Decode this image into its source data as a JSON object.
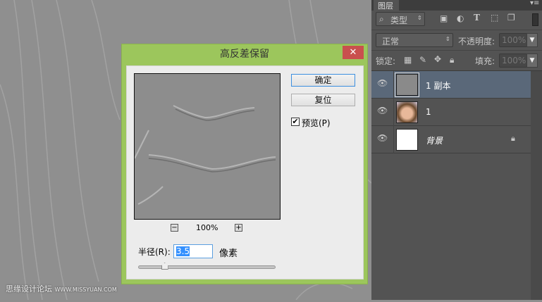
{
  "dialog": {
    "title": "高反差保留",
    "close_label": "✕",
    "ok_label": "确定",
    "reset_label": "复位",
    "preview_label": "预览(P)",
    "preview_checked": true,
    "zoom_out_label": "−",
    "zoom_level": "100%",
    "zoom_in_label": "+",
    "radius_label": "半径(R):",
    "radius_value": "3.5",
    "radius_unit": "像素",
    "radius_slider_fraction": 0.19
  },
  "layers_panel": {
    "tab_label": "图层",
    "filter_label": "类型",
    "blend_mode": "正常",
    "opacity_label": "不透明度:",
    "opacity_value": "100%",
    "lock_label": "锁定:",
    "fill_label": "填充:",
    "fill_value": "100%",
    "layers": [
      {
        "name": "1 副本",
        "selected": true,
        "thumb": "high-pass"
      },
      {
        "name": "1",
        "selected": false,
        "thumb": "photo"
      },
      {
        "name": "背景",
        "selected": false,
        "thumb": "white",
        "locked": true
      }
    ]
  },
  "watermark": {
    "text": "思缘设计论坛",
    "url": "WWW.MISSYUAN.COM"
  }
}
